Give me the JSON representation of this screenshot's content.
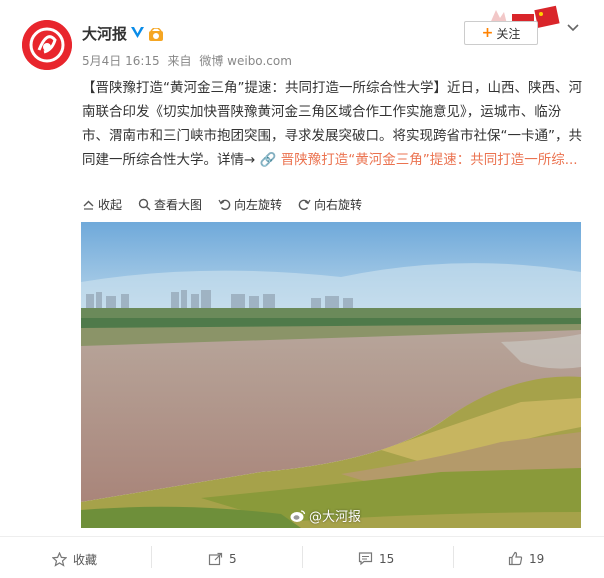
{
  "user": {
    "name": "大河报",
    "meta_date": "5月4日 16:15",
    "meta_from": "来自",
    "meta_source": "微博 weibo.com"
  },
  "follow_label": "关注",
  "post": {
    "text_before": "【晋陕豫打造“黄河金三角”提速：共同打造一所综合性大学】近日，山西、陕西、河南联合印发《切实加快晋陕豫黄河金三角区域合作工作实施意见》，运城市、临汾市、渭南市和三门峡市抱团突围，寻求发展突破口。将实现跨省市社保“一卡通”，共同建一所综合性大学。详情→",
    "link_icon": "🔗",
    "link_text": "晋陕豫打造“黄河金三角”提速：共同打造一所综..."
  },
  "image_toolbar": {
    "collapse": "收起",
    "view_large": "查看大图",
    "rotate_left": "向左旋转",
    "rotate_right": "向右旋转"
  },
  "watermark": "@大河报",
  "actions": {
    "favorite": "收藏",
    "share_count": "5",
    "comment_count": "15",
    "like_count": "19"
  },
  "colors": {
    "brand_red": "#e8262d",
    "link": "#eb7350",
    "follow_plus": "#ff8200"
  }
}
